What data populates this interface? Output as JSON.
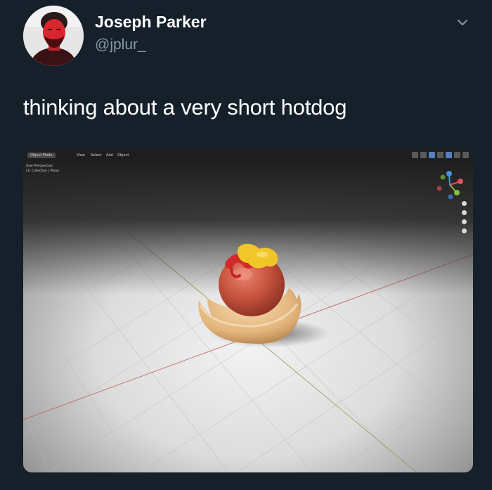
{
  "tweet": {
    "display_name": "Joseph Parker",
    "handle": "@jplur_",
    "text": "thinking about a very short hotdog",
    "more_icon": "chevron-down-icon"
  },
  "viewport": {
    "mode_label": "Object Mode",
    "menu": [
      "View",
      "Select",
      "Add",
      "Object"
    ],
    "perspective_label": "User Perspective",
    "collection_label": "(1) Collection | Plane",
    "colors": {
      "background": "#15202b",
      "name": "#ffffff",
      "handle": "#8899a6",
      "floor": "#d9d9d9",
      "x_axis": "#b75a5a",
      "y_axis": "#8a9a55",
      "gizmo_x": "#e0505a",
      "gizmo_y": "#7fbf3f",
      "gizmo_z": "#4a8fe0"
    }
  }
}
